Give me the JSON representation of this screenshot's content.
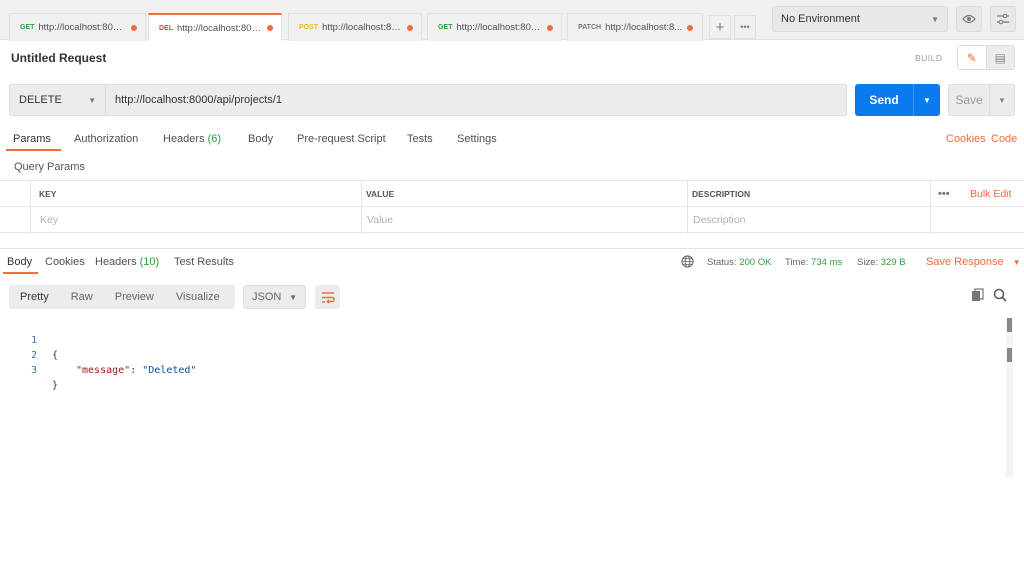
{
  "tabs": [
    {
      "method": "GET",
      "url": "http://localhost:800..."
    },
    {
      "method": "DEL",
      "url": "http://localhost:800..."
    },
    {
      "method": "POST",
      "url": "http://localhost:80..."
    },
    {
      "method": "GET",
      "url": "http://localhost:800..."
    },
    {
      "method": "PATCH",
      "url": "http://localhost:8..."
    }
  ],
  "tab_actions": {
    "add": "+",
    "more": "•••"
  },
  "environment": {
    "selected": "No Environment"
  },
  "request": {
    "title": "Untitled Request",
    "build_label": "BUILD",
    "method": "DELETE",
    "url": "http://localhost:8000/api/projects/1",
    "send_label": "Send",
    "save_label": "Save"
  },
  "request_tabs": {
    "params": "Params",
    "authorization": "Authorization",
    "headers": "Headers",
    "headers_count": "(6)",
    "body": "Body",
    "prerequest": "Pre-request Script",
    "tests": "Tests",
    "settings": "Settings",
    "cookies": "Cookies",
    "code": "Code"
  },
  "query_params": {
    "title": "Query Params",
    "columns": {
      "key": "KEY",
      "value": "VALUE",
      "description": "DESCRIPTION"
    },
    "more": "•••",
    "bulk_edit": "Bulk Edit",
    "placeholders": {
      "key": "Key",
      "value": "Value",
      "description": "Description"
    }
  },
  "response_tabs": {
    "body": "Body",
    "cookies": "Cookies",
    "headers": "Headers",
    "headers_count": "(10)",
    "test_results": "Test Results"
  },
  "response_status": {
    "status_label": "Status:",
    "status_value": "200 OK",
    "time_label": "Time:",
    "time_value": "734 ms",
    "size_label": "Size:",
    "size_value": "329 B",
    "save_response": "Save Response"
  },
  "view_modes": {
    "pretty": "Pretty",
    "raw": "Raw",
    "preview": "Preview",
    "visualize": "Visualize"
  },
  "format": "JSON",
  "code": {
    "line_numbers": [
      "1",
      "2",
      "3"
    ],
    "open_brace": "{",
    "key": "\"message\"",
    "colon": ": ",
    "value": "\"Deleted\"",
    "close_brace": "}"
  },
  "colors": {
    "accent": "#f26b3a",
    "send": "#097bed",
    "success": "#2e9e3f"
  }
}
